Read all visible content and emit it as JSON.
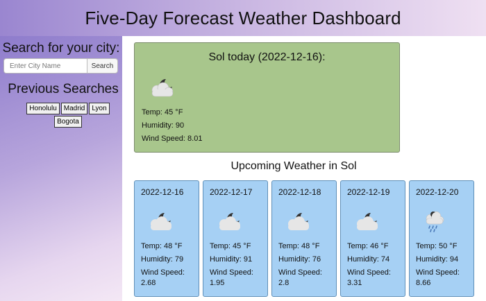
{
  "header": {
    "title": "Five-Day Forecast Weather Dashboard"
  },
  "sidebar": {
    "search_title": "Search for your city:",
    "search_placeholder": "Enter City Name",
    "search_button": "Search",
    "previous_title": "Previous Searches",
    "previous": [
      "Honolulu",
      "Madrid",
      "Lyon",
      "Bogota"
    ]
  },
  "today": {
    "title": "Sol today (2022-12-16):",
    "icon": "partly-cloudy-night-icon",
    "temp": "Temp: 45 °F",
    "humidity": "Humidity: 90",
    "wind": "Wind Speed: 8.01"
  },
  "upcoming": {
    "title": "Upcoming Weather in Sol",
    "days": [
      {
        "date": "2022-12-16",
        "icon": "partly-cloudy-night-icon",
        "temp": "Temp: 48 °F",
        "humidity": "Humidity: 79",
        "wind_label": "Wind Speed:",
        "wind_value": "2.68"
      },
      {
        "date": "2022-12-17",
        "icon": "partly-cloudy-night-icon",
        "temp": "Temp: 45 °F",
        "humidity": "Humidity: 91",
        "wind_label": "Wind Speed:",
        "wind_value": "1.95"
      },
      {
        "date": "2022-12-18",
        "icon": "partly-cloudy-night-icon",
        "temp": "Temp: 48 °F",
        "humidity": "Humidity: 76",
        "wind_label": "Wind Speed:",
        "wind_value": "2.8"
      },
      {
        "date": "2022-12-19",
        "icon": "partly-cloudy-night-icon",
        "temp": "Temp: 46 °F",
        "humidity": "Humidity: 74",
        "wind_label": "Wind Speed:",
        "wind_value": "3.31"
      },
      {
        "date": "2022-12-20",
        "icon": "rain-cloud-icon",
        "temp": "Temp: 50 °F",
        "humidity": "Humidity: 94",
        "wind_label": "Wind Speed:",
        "wind_value": "8.66"
      }
    ]
  },
  "colors": {
    "today_card": "#a8c68c",
    "forecast_card": "#a6d0f4",
    "header_start": "#9a86d0",
    "header_end": "#efe0f2"
  }
}
